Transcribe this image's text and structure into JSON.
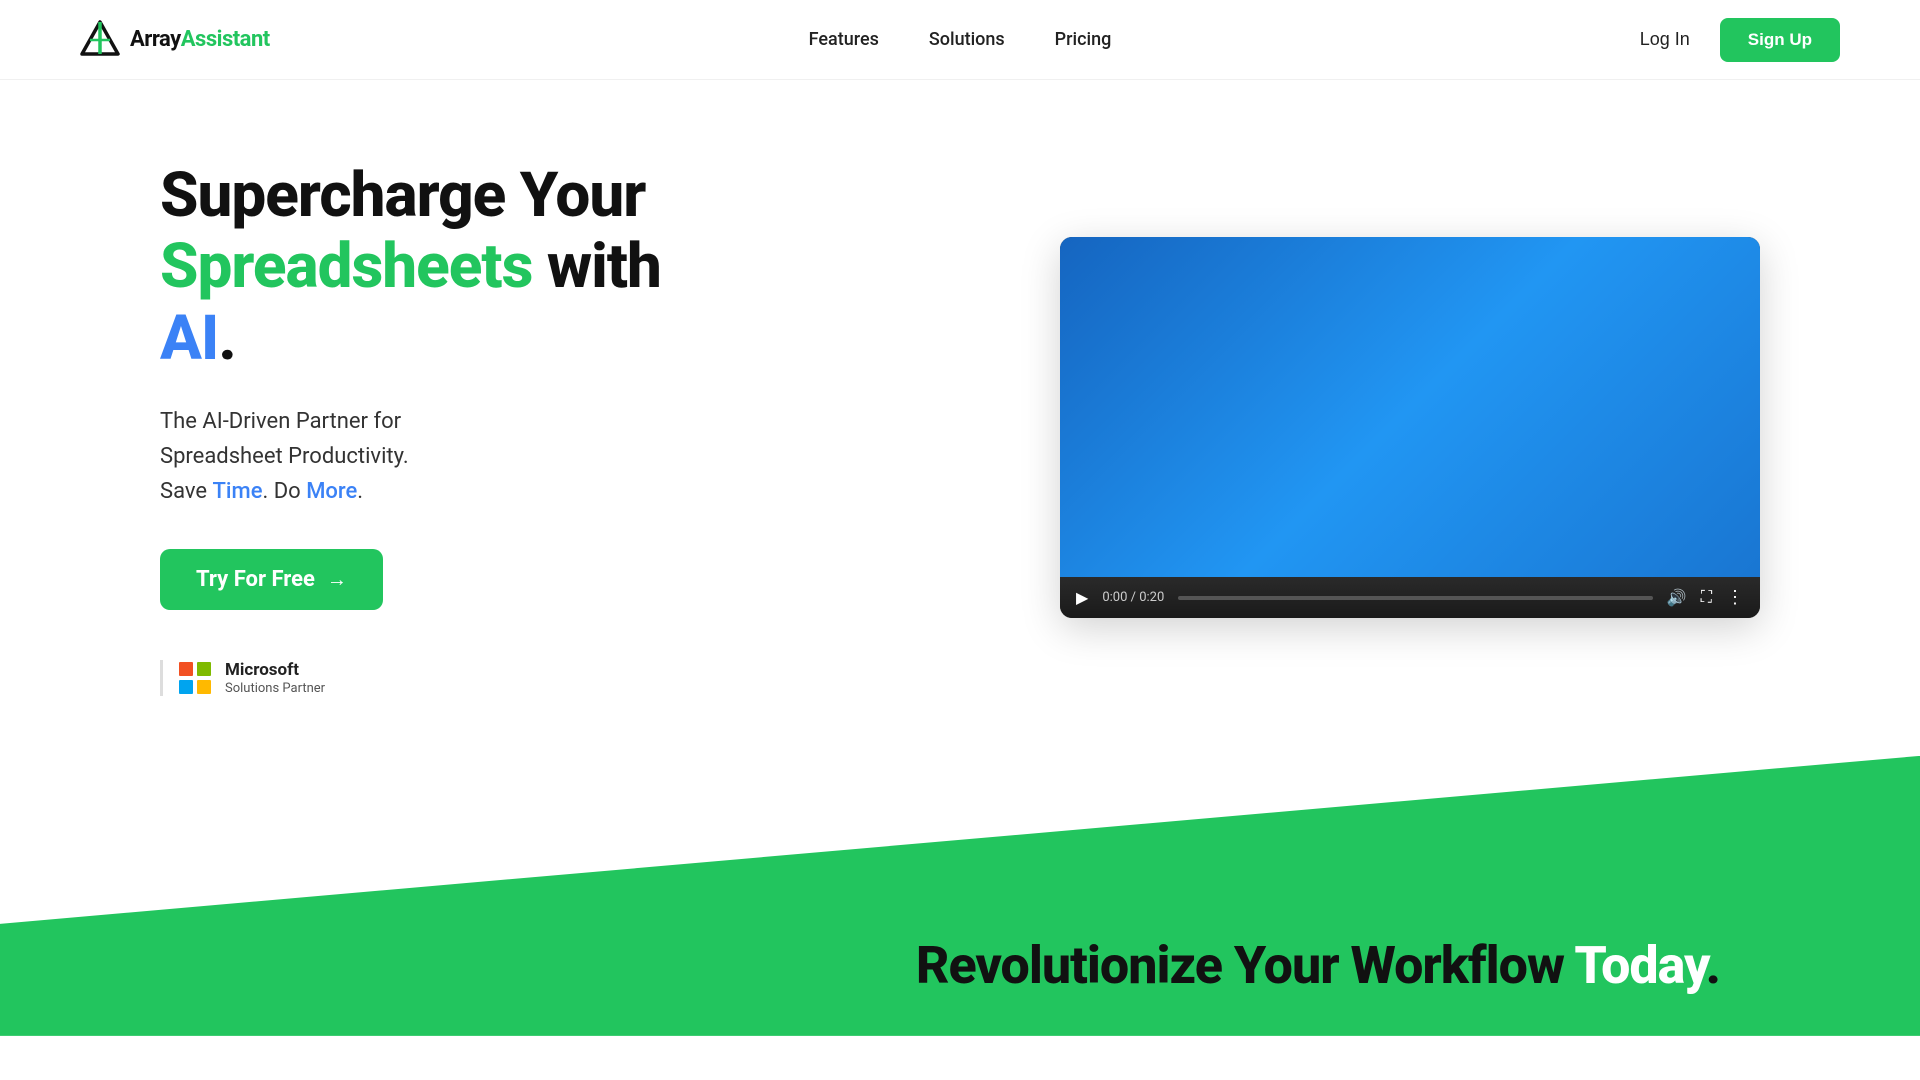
{
  "navbar": {
    "logo_text_part1": "Array",
    "logo_text_part2": "Assistant",
    "nav_items": [
      {
        "label": "Features",
        "id": "features"
      },
      {
        "label": "Solutions",
        "id": "solutions"
      },
      {
        "label": "Pricing",
        "id": "pricing"
      }
    ],
    "login_label": "Log In",
    "signup_label": "Sign Up"
  },
  "hero": {
    "title_line1": "Supercharge Your",
    "title_green": "Spreadsheets",
    "title_mid": " with ",
    "title_blue": "AI",
    "title_end": ".",
    "subtitle_prefix": "The AI-Driven Partner for Spreadsheet Productivity.\nSave ",
    "subtitle_time": "Time",
    "subtitle_mid": ". Do ",
    "subtitle_more": "More",
    "subtitle_end": ".",
    "cta_label": "Try For Free",
    "ms_name": "Microsoft",
    "ms_partner_label": "Solutions Partner"
  },
  "video": {
    "time": "0:00 / 0:20"
  },
  "bottom": {
    "text_prefix": "Revolutionize Your Workflow ",
    "text_highlight": "Today",
    "text_end": "."
  },
  "icons": {
    "play": "▶",
    "volume": "🔊",
    "fullscreen": "⛶",
    "more": "⋮",
    "arrow": "→"
  }
}
